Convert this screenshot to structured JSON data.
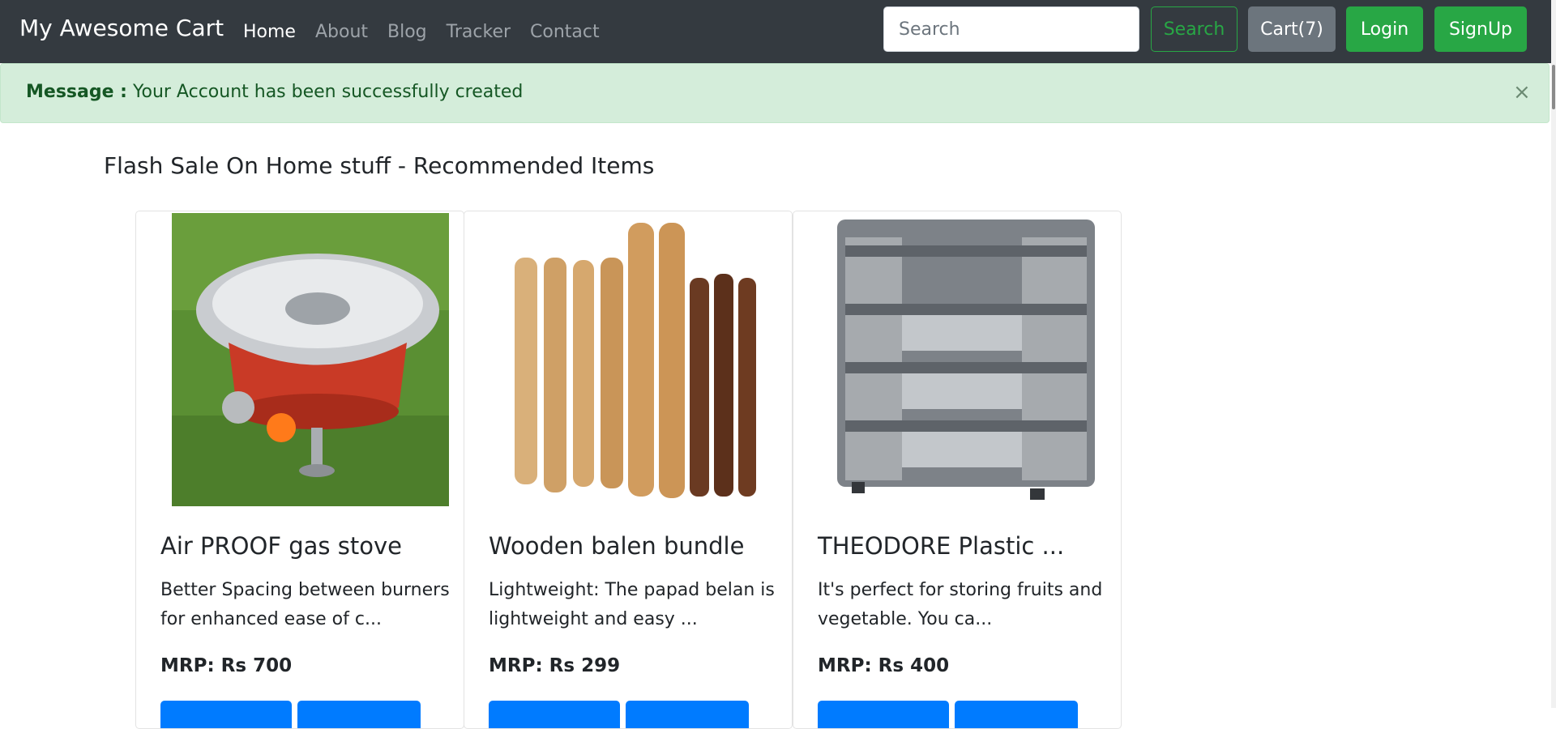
{
  "navbar": {
    "brand": "My Awesome Cart",
    "links": [
      {
        "label": "Home",
        "active": true
      },
      {
        "label": "About",
        "active": false
      },
      {
        "label": "Blog",
        "active": false
      },
      {
        "label": "Tracker",
        "active": false
      },
      {
        "label": "Contact",
        "active": false
      }
    ],
    "search_placeholder": "Search",
    "search_button": "Search",
    "cart_button": "Cart(7)",
    "login_button": "Login",
    "signup_button": "SignUp"
  },
  "alert": {
    "label": "Message :",
    "text": " Your Account has been successfully created",
    "close": "×"
  },
  "section": {
    "title": "Flash Sale On Home stuff - Recommended Items"
  },
  "products": [
    {
      "title": "Air PROOF gas stove",
      "description": "Better Spacing between burners for enhanced ease of c...",
      "price": "MRP: Rs 700",
      "image": "gas-stove-image"
    },
    {
      "title": "Wooden balen bundle",
      "description": "Lightweight: The papad belan is lightweight and easy ...",
      "price": "MRP: Rs 299",
      "image": "rolling-pins-image"
    },
    {
      "title": "THEODORE Plastic ...",
      "description": "It's perfect for storing fruits and vegetable. You ca...",
      "price": "MRP: Rs 400",
      "image": "plastic-rack-image"
    }
  ],
  "colors": {
    "navbar": "#343a40",
    "success": "#28a745",
    "secondary": "#6c757d",
    "primary": "#007bff",
    "alert_bg": "#d4edda",
    "alert_text": "#155724"
  }
}
